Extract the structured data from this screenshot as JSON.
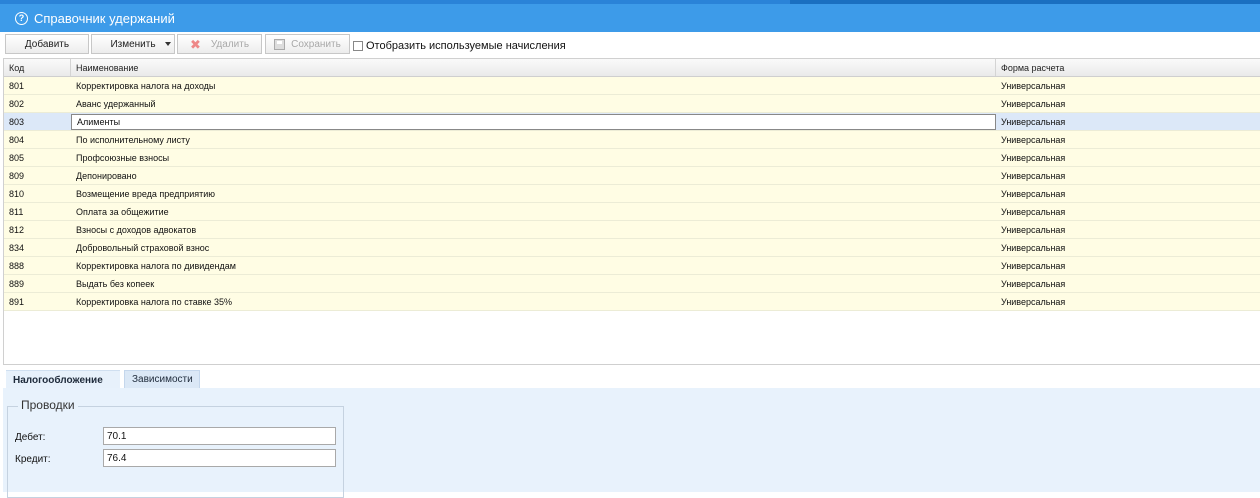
{
  "window": {
    "title": "Справочник удержаний"
  },
  "toolbar": {
    "add_label": "Добавить",
    "edit_label": "Изменить",
    "delete_label": "Удалить",
    "save_label": "Сохранить",
    "show_used_label": "Отобразить используемые начисления",
    "show_used_checked": false
  },
  "grid": {
    "columns": [
      "Код",
      "Наименование",
      "Форма расчета"
    ],
    "rows": [
      {
        "code": "801",
        "name": "Корректировка налога на доходы",
        "form": "Универсальная"
      },
      {
        "code": "802",
        "name": "Аванс удержанный",
        "form": "Универсальная"
      },
      {
        "code": "803",
        "name": "Алименты",
        "form": "Универсальная"
      },
      {
        "code": "804",
        "name": "По исполнительному листу",
        "form": "Универсальная"
      },
      {
        "code": "805",
        "name": "Профсоюзные взносы",
        "form": "Универсальная"
      },
      {
        "code": "809",
        "name": "Депонировано",
        "form": "Универсальная"
      },
      {
        "code": "810",
        "name": "Возмещение вреда предприятию",
        "form": "Универсальная"
      },
      {
        "code": "811",
        "name": "Оплата за общежитие",
        "form": "Универсальная"
      },
      {
        "code": "812",
        "name": "Взносы с доходов адвокатов",
        "form": "Универсальная"
      },
      {
        "code": "834",
        "name": "Добровольный страховой взнос",
        "form": "Универсальная"
      },
      {
        "code": "888",
        "name": "Корректировка налога по дивидендам",
        "form": "Универсальная"
      },
      {
        "code": "889",
        "name": "Выдать без копеек",
        "form": "Универсальная"
      },
      {
        "code": "891",
        "name": "Корректировка налога по ставке 35%",
        "form": "Универсальная"
      }
    ],
    "selected_code": "803"
  },
  "tabs": [
    {
      "label": "Налогообложение",
      "active": true
    },
    {
      "label": "Зависимости",
      "active": false
    }
  ],
  "postings": {
    "legend": "Проводки",
    "debit_label": "Дебет:",
    "debit_value": "70.1",
    "credit_label": "Кредит:",
    "credit_value": "76.4"
  },
  "colors": {
    "titlebar": "#3d9be9",
    "row_bg": "#fffde4",
    "selected_row_bg": "#dce8f8",
    "panel_bg": "#e8f2fc"
  },
  "icons": {
    "title": "help-icon",
    "delete": "x-icon",
    "save": "floppy-icon",
    "edit_dropdown": "chevron-down-icon"
  }
}
